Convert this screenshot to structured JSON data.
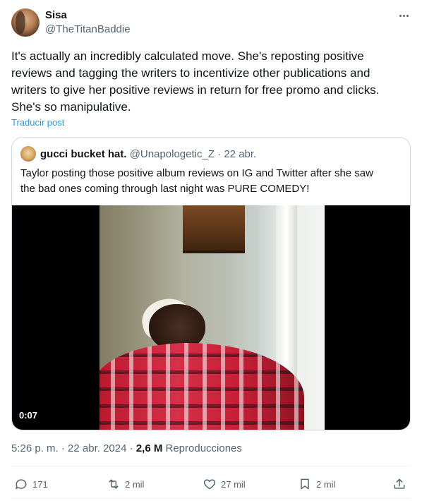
{
  "author": {
    "name": "Sisa",
    "handle": "@TheTitanBaddie"
  },
  "tweet": {
    "text": "It's actually an incredibly calculated move. She's reposting positive\nreviews and tagging the writers to incentivize other publications and\nwriters to give her positive reviews in return for free promo and clicks.\nShe's so manipulative.",
    "translate_label": "Traducir post"
  },
  "quoted": {
    "name": "gucci bucket hat.",
    "handle": "@Unapologetic_Z",
    "separator": "·",
    "date": "22 abr.",
    "text": "Taylor posting those positive album reviews on IG and Twitter after she saw\nthe bad ones coming through last night was PURE COMEDY!",
    "video_duration": "0:07"
  },
  "meta": {
    "time": "5:26 p. m.",
    "separator": "·",
    "date": "22 abr. 2024",
    "views_count": "2,6 M",
    "views_label": "Reproducciones"
  },
  "actions": {
    "replies": "171",
    "reposts": "2 mil",
    "likes": "27 mil",
    "bookmarks": "2 mil"
  },
  "icons": {
    "more": "more-icon",
    "reply": "reply-icon",
    "repost": "repost-icon",
    "like": "heart-icon",
    "bookmark": "bookmark-icon",
    "share": "share-icon"
  },
  "colors": {
    "link": "#1d9bf0",
    "secondary_text": "#536471",
    "primary_text": "#0f1419"
  }
}
